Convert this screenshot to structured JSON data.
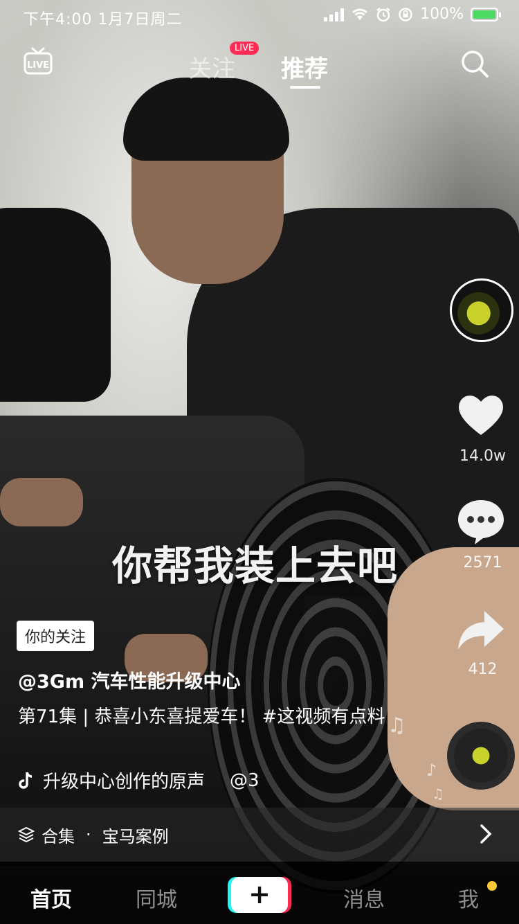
{
  "status_bar": {
    "time": "下午4:00   1月7日周二",
    "battery_text": "100%"
  },
  "top_nav": {
    "live_icon": "live-tv-icon",
    "tabs": [
      {
        "label": "关注",
        "badge": "LIVE"
      },
      {
        "label": "推荐"
      }
    ],
    "search_icon": "search-icon"
  },
  "subtitle": "你帮我装上去吧",
  "right_rail": {
    "like_count": "14.0w",
    "comment_count": "2571",
    "share_count": "412"
  },
  "video_info": {
    "follow_tag": "你的关注",
    "author": "@3Gm 汽车性能升级中心",
    "description": "第71集 | 恭喜小东喜提爱车！ #这视频有点料",
    "music": "升级中心创作的原声",
    "music_extra": "@3"
  },
  "collection": {
    "prefix": "合集",
    "separator": "·",
    "name": "宝马案例"
  },
  "tab_bar": {
    "home": "首页",
    "local": "同城",
    "plus": "+",
    "messages": "消息",
    "me": "我"
  },
  "colors": {
    "brand_red": "#fe2c55",
    "brand_cyan": "#25f4ee",
    "notification_dot": "#fdc93a"
  }
}
